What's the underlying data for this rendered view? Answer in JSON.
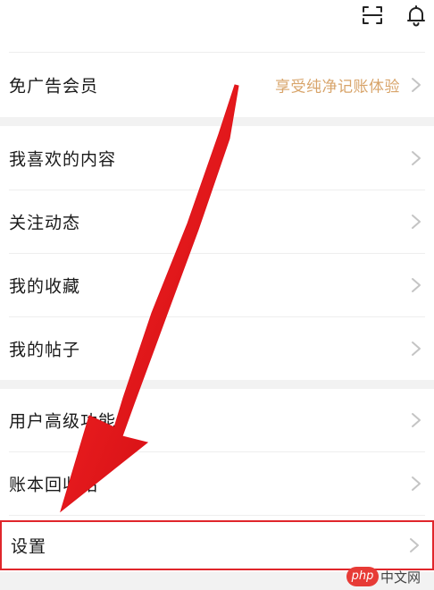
{
  "header": {
    "icons": [
      "scan-icon",
      "bell-icon"
    ]
  },
  "vip_row": {
    "label": "免广告会员",
    "promo": "享受纯净记账体验"
  },
  "group_content": [
    {
      "label": "我喜欢的内容"
    },
    {
      "label": "关注动态"
    },
    {
      "label": "我的收藏"
    },
    {
      "label": "我的帖子"
    }
  ],
  "group_tools": [
    {
      "label": "用户高级功能"
    },
    {
      "label": "账本回收站"
    }
  ],
  "settings_row": {
    "label": "设置"
  },
  "annotation": {
    "arrow_color": "#e0131a",
    "highlight_color": "#e0262b"
  },
  "watermark": {
    "badge": "php",
    "text": "中文网"
  },
  "colors": {
    "promo": "#d8a46a",
    "separator": "#f2f2f2",
    "chevron": "#c4c4c4"
  }
}
